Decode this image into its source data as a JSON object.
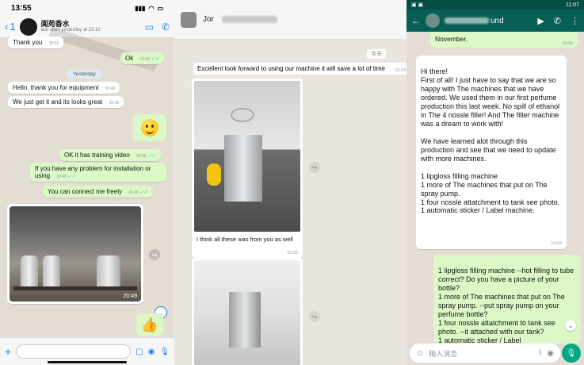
{
  "panel1": {
    "status_time": "13:55",
    "back_count": "1",
    "contact_name": "阆苑香水",
    "last_seen": "last seen yesterday at 23:10",
    "messages": [
      {
        "text": "Thank you",
        "time": "18:59"
      },
      {
        "text": "Ok",
        "time": "18:59"
      },
      {
        "text": "Yesterday"
      },
      {
        "text": "Hello, thank you for equipment",
        "time": "20:48"
      },
      {
        "text": "We just get it and its looks great",
        "time": "20:48"
      },
      {
        "text": "",
        "time": "20:48"
      },
      {
        "text": "OK it has training video",
        "time": "20:48"
      },
      {
        "text": "If you have any problem for installation or using",
        "time": "20:48"
      },
      {
        "text": "You can connect me freely",
        "time": "20:48"
      },
      {
        "text": "",
        "time": "20:49"
      }
    ]
  },
  "panel2": {
    "contact_name": "Jor",
    "day_label": "今天",
    "messages": [
      {
        "text": "Excellent look forward to using our machine it will save a lot of time",
        "time": "15:24"
      },
      {
        "text": "I think all these was from you as well",
        "time": "15:25"
      }
    ]
  },
  "panel3": {
    "status_time": "11:07",
    "contact_name": "und",
    "top_message": {
      "text": "November.",
      "time": "14:45"
    },
    "in_message": {
      "text": "Hi there!\nFirst of all! I just have to say that we are so happy with The machines that we have ordered. We used them in our first perfume production this last week. No spill of ethanol in The 4 nossle filler! And The filter machine was a dream to work with!\n\nWe have learned alot through this production and see that we need to update with more machines.\n\n1 lipgloss filling machine\n1 more of The machines that put on The spray pump.\n1 four nossle attatchment to tank see photo.\n1 automatic sticker / Label machine.",
      "time": "14:53"
    },
    "out_message": {
      "text": "1 lipgloss filling machine --hot filling to tube correct? Do you have a picture of your bottle?\n1 more of The machines that put on The spray pump. --put spray pump on your perfume bottle?\n1 four nossle attatchment to tank see photo. --it attached with our tank?\n1 automatic sticker / Label"
    },
    "input_placeholder": "输入消息"
  }
}
